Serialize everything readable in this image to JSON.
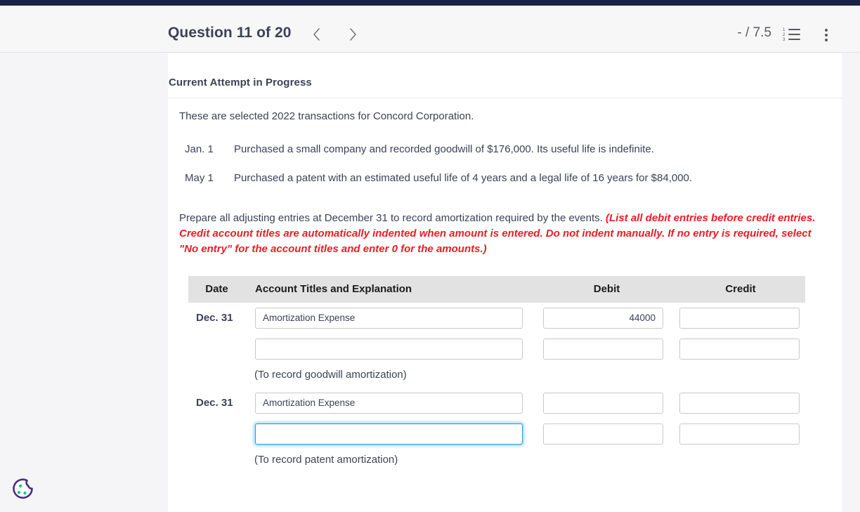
{
  "header": {
    "question_title": "Question 11 of 20",
    "prev_icon": "chevron-left-icon",
    "next_icon": "chevron-right-icon",
    "score": "- / 7.5",
    "list_icon": "numbered-list-icon",
    "more_icon": "more-vertical-icon",
    "list_numbers": [
      "1",
      "2",
      "3"
    ]
  },
  "content": {
    "attempt_title": "Current Attempt in Progress",
    "lead": "These are selected 2022 transactions for Concord Corporation.",
    "transactions": [
      {
        "date": "Jan. 1",
        "description": "Purchased a small company and recorded goodwill of $176,000. Its useful life is indefinite."
      },
      {
        "date": "May 1",
        "description": "Purchased a patent with an estimated useful life of 4 years and a legal life of 16 years for $84,000."
      }
    ],
    "instruction_plain": "Prepare all adjusting entries at December 31 to record amortization required by the events.",
    "instruction_red": "(List all debit entries before credit entries. Credit account titles are automatically indented when amount is entered. Do not indent manually. If no entry is required, select \"No entry\" for the account titles and enter 0 for the amounts.)"
  },
  "table": {
    "headers": {
      "date": "Date",
      "account": "Account Titles and Explanation",
      "debit": "Debit",
      "credit": "Credit"
    },
    "rows": [
      {
        "date": "Dec. 31",
        "account_value": "Amortization Expense",
        "debit_value": "44000",
        "credit_value": "",
        "focused": "false"
      },
      {
        "date": "",
        "account_value": "",
        "debit_value": "",
        "credit_value": "",
        "focused": "false"
      },
      {
        "date": "Dec. 31",
        "account_value": "Amortization Expense",
        "debit_value": "",
        "credit_value": "",
        "focused": "false"
      },
      {
        "date": "",
        "account_value": "",
        "debit_value": "",
        "credit_value": "",
        "focused": "true"
      }
    ],
    "caption_goodwill": "(To record goodwill amortization)",
    "caption_patent": "(To record patent amortization)"
  },
  "widgets": {
    "cookie_icon": "cookie-consent-icon"
  },
  "colors": {
    "top_strip": "#19204a",
    "instruction_red": "#ec1c24",
    "focus_blue": "#2f9bdd",
    "table_header_bg": "#e2e2e2",
    "text": "#3c4257"
  }
}
